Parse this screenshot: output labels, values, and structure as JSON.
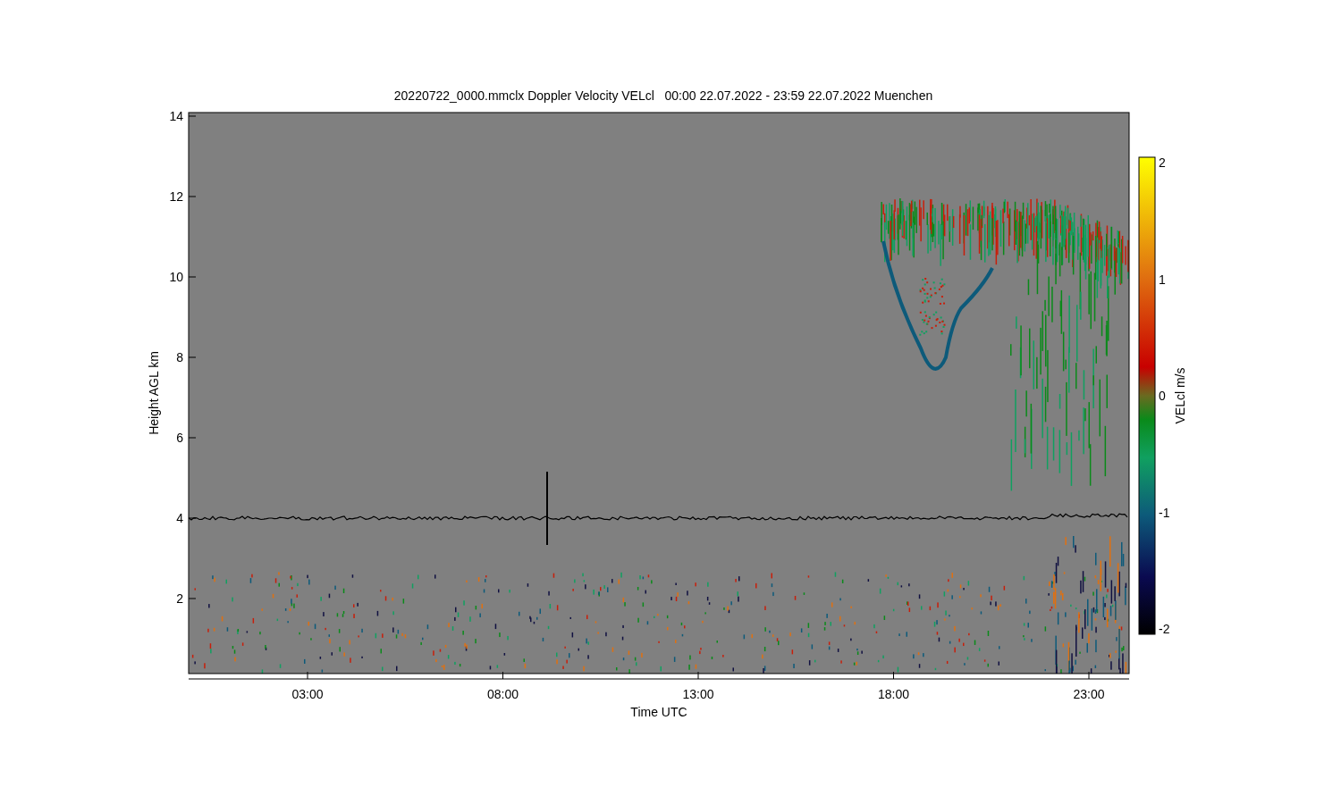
{
  "title": "20220722_0000.mmclx Doppler Velocity VELcl   00:00 22.07.2022 - 23:59 22.07.2022 Muenchen",
  "y_axis": {
    "label": "Height AGL km",
    "ticks": [
      "14",
      "12",
      "10",
      "8",
      "6",
      "4",
      "2"
    ]
  },
  "x_axis": {
    "label": "Time UTC",
    "ticks": [
      "03:00",
      "08:00",
      "13:00",
      "18:00",
      "23:00"
    ]
  },
  "colorbar": {
    "label": "VELcl m/s",
    "ticks": [
      "2",
      "1",
      "0",
      "-1",
      "-2"
    ]
  }
}
